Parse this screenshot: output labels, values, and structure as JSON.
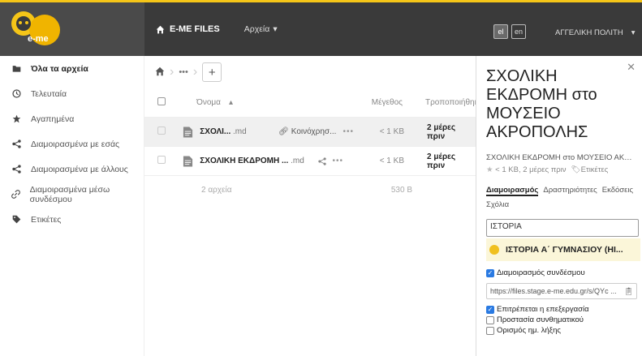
{
  "header": {
    "logo_text": "e-me",
    "app_title": "E-ME FILES",
    "files_menu": "Αρχεία",
    "lang_el": "el",
    "lang_en": "en",
    "user_name": "ΑΓΓΕΛΙΚΗ ΠΟΛΙΤΗ"
  },
  "sidebar": {
    "items": [
      {
        "label": "Όλα τα αρχεία",
        "icon": "folder-icon"
      },
      {
        "label": "Τελευταία",
        "icon": "clock-icon"
      },
      {
        "label": "Αγαπημένα",
        "icon": "star-icon"
      },
      {
        "label": "Διαμοιρασμένα με εσάς",
        "icon": "share-icon"
      },
      {
        "label": "Διαμοιρασμένα με άλλους",
        "icon": "share-icon"
      },
      {
        "label": "Διαμοιρασμένα μέσω συνδέσμου",
        "icon": "link-icon"
      },
      {
        "label": "Ετικέτες",
        "icon": "tag-icon"
      }
    ]
  },
  "main": {
    "columns": {
      "name": "Όνομα",
      "size": "Μέγεθος",
      "modified": "Τροποποιήθηκε"
    },
    "files": [
      {
        "name": "ΣΧΟΛΙ...",
        "ext": ".md",
        "share": "Κοινόχρησ...",
        "size": "< 1 KB",
        "modified": "2 μέρες πριν"
      },
      {
        "name": "ΣΧΟΛΙΚΗ ΕΚΔΡΟΜΗ ...",
        "ext": ".md",
        "share": "",
        "size": "< 1 KB",
        "modified": "2 μέρες πριν"
      }
    ],
    "summary_count": "2 αρχεία",
    "summary_size": "530 B"
  },
  "panel": {
    "title": "ΣΧΟΛΙΚΗ ΕΚΔΡΟΜΗ στο ΜΟΥΣΕΙΟ ΑΚΡΟΠΟΛΗΣ",
    "subtitle": "ΣΧΟΛΙΚΗ ΕΚΔΡΟΜΗ στο ΜΟΥΣΕΙΟ ΑΚΡ...",
    "meta": "< 1 KB, 2 μέρες πριν",
    "tags": "Ετικέτες",
    "tabs": [
      "Διαμοιρασμός",
      "Δραστηριότητες",
      "Εκδόσεις",
      "Σχόλια"
    ],
    "share_input_value": "ΙΣΤΟΡΙΑ",
    "suggestion": "ΙΣΤΟΡΙΑ Α΄ ΓΥΜΝΑΣΙΟΥ (ΗΙ...",
    "link_share_label": "Διαμοιρασμός συνδέσμου",
    "link_url": "https://files.stage.e-me.edu.gr/s/QYc ...",
    "allow_edit_label": "Επιτρέπεται η επεξεργασία",
    "password_label": "Προστασία συνθηματικού",
    "expiry_label": "Ορισμός ημ. λήξης"
  }
}
